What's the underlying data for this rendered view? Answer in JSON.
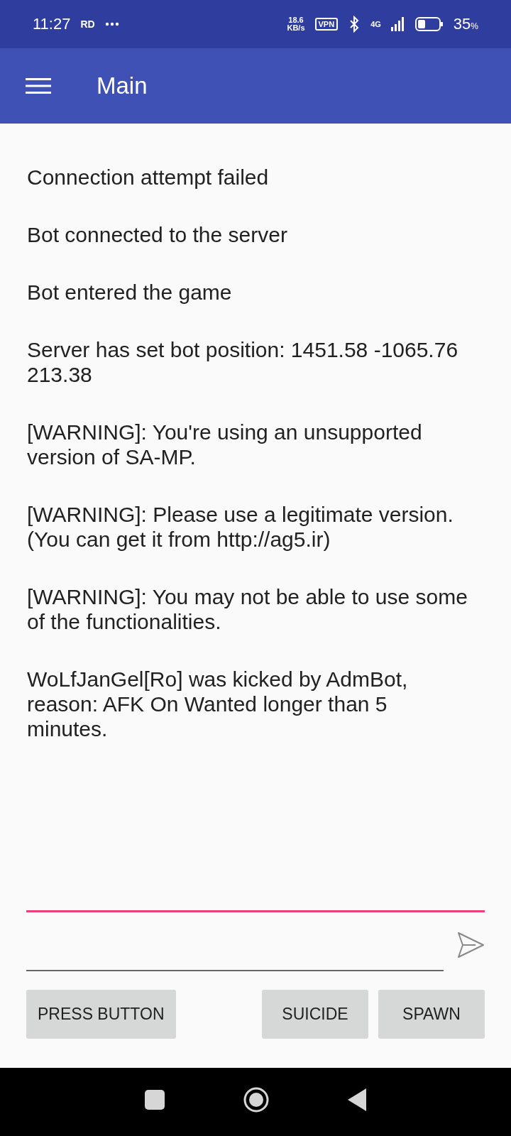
{
  "status_bar": {
    "time": "11:27",
    "carrier": "RD",
    "speed_value": "18.6",
    "speed_unit": "KB/s",
    "vpn": "VPN",
    "network": "4G",
    "battery_percent": "35",
    "battery_unit": "%"
  },
  "app_bar": {
    "title": "Main"
  },
  "log": [
    {
      "text": "Connection attempt failed"
    },
    {
      "text": "Bot connected to the server"
    },
    {
      "text": "Bot entered the game"
    },
    {
      "text": "Server has set bot position: 1451.58 -1065.76 213.38"
    },
    {
      "text": "[WARNING]: You're using an unsupported version of SA-MP."
    },
    {
      "text": "[WARNING]: Please use a legitimate version. (You can get it from http://ag5.ir)"
    },
    {
      "text": "[WARNING]: You may not be able to use some of the functionalities."
    },
    {
      "text": "WoLfJanGel[Ro] was kicked by AdmBot, reason: AFK On Wanted longer than 5 minutes."
    }
  ],
  "message_field": {
    "focused": false
  },
  "left_buttons": [
    {
      "label": "PRESS BUTTON"
    }
  ],
  "right_buttons": [
    {
      "label": "SUICIDE"
    },
    {
      "label": "SPAWN"
    }
  ]
}
